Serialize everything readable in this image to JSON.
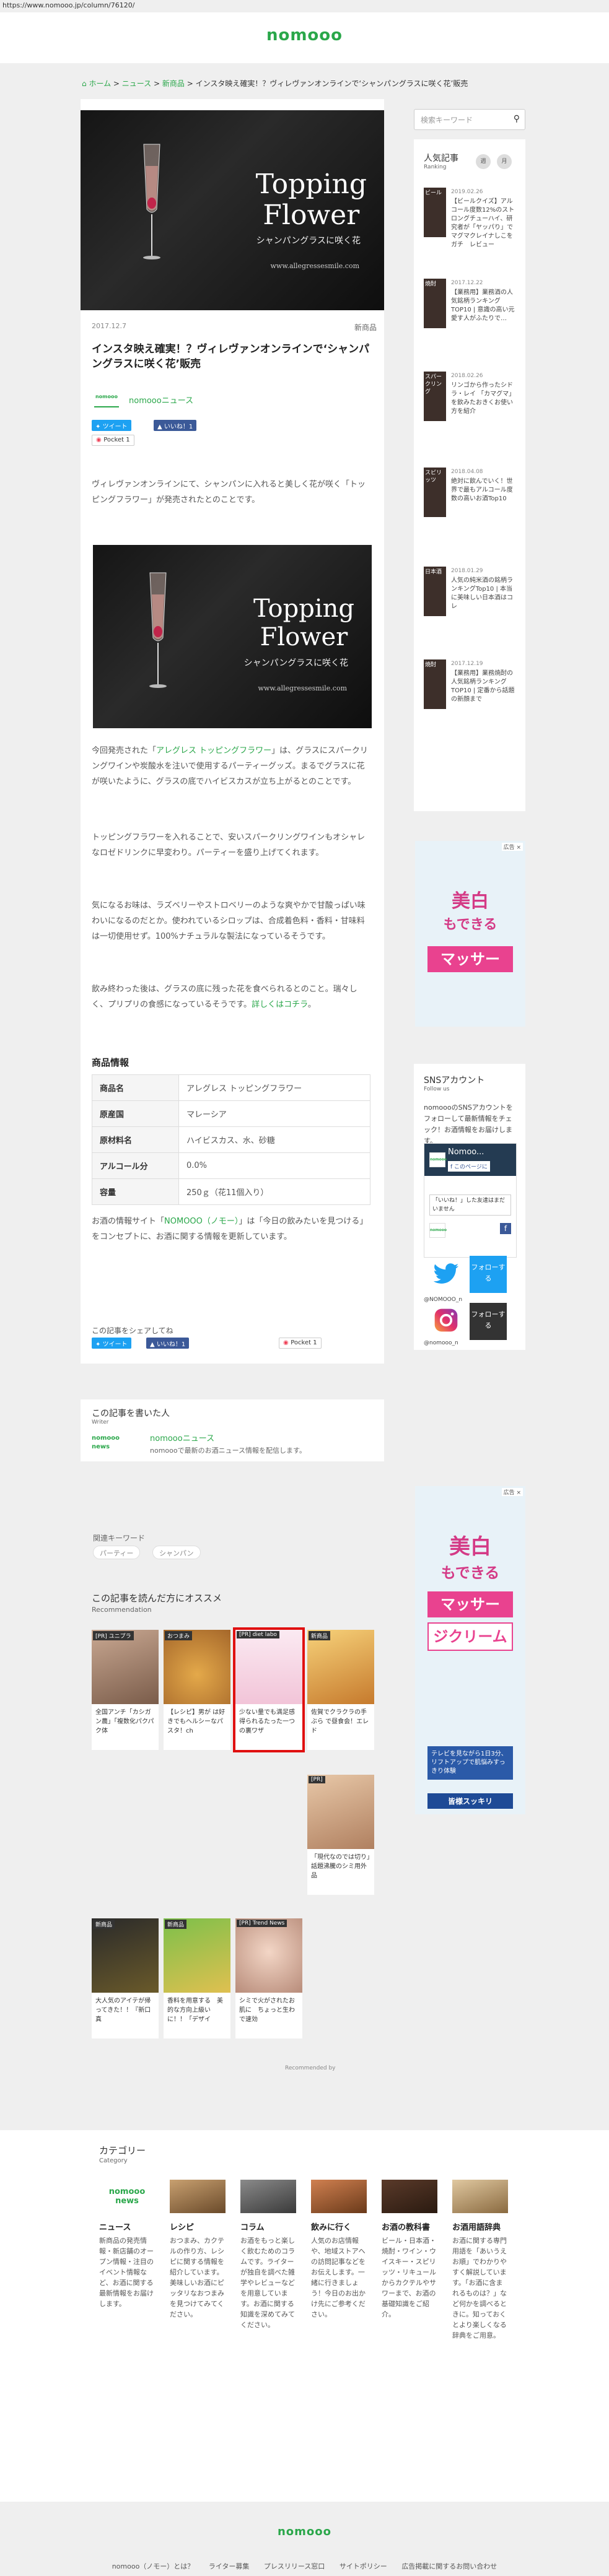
{
  "url": "https://www.nomooo.jp/column/76120/",
  "site_logo": "nomooo",
  "breadcrumb": {
    "home": "ホーム",
    "sep1": " > ",
    "news": "ニュース",
    "sep2": " > ",
    "newproduct": "新商品",
    "sep3": " > ",
    "current": "インスタ映え確実！？ヴィレヴァンオンラインで‘シャンパングラスに咲く花’販売"
  },
  "hero": {
    "title_line1": "Topping",
    "title_line2": "Flower",
    "subtitle": "シャンパングラスに咲く花",
    "url": "www.allegressesmile.com"
  },
  "article": {
    "date": "2017.12.7",
    "category": "新商品",
    "title": "インスタ映え確実！？ヴィレヴァンオンラインで‘シャンパングラスに咲く花’販売",
    "author": "nomoooニュース",
    "author_logo": "nomooo",
    "share": {
      "tweet": "ツイート",
      "like": "いいね！1",
      "pocket": "Pocket",
      "pocket_count": "1"
    },
    "p1": "ヴィレヴァンオンラインにて、シャンパンに入れると美しく花が咲く「トッピングフラワー」が発売されたとのことです。",
    "p2a": "今回発売された「",
    "p2link": "アレグレス トッピングフラワー",
    "p2b": "」は、グラスにスパークリングワインや炭酸水を注いで使用するパーティーグッズ。まるでグラスに花が咲いたように、グラスの底でハイビスカスが立ち上がるとのことです。",
    "p3": "トッピングフラワーを入れることで、安いスパークリングワインもオシャレなロゼドリンクに早変わり。パーティーを盛り上げてくれます。",
    "p4": "気になるお味は、ラズベリーやストロベリーのような爽やかで甘酸っぱい味わいになるのだとか。使われているシロップは、合成着色料・香料・甘味料は一切使用せず。100%ナチュラルな製法になっているそうです。",
    "p5a": "飲み終わった後は、グラスの底に残った花を食べられるとのこと。瑞々しく、プリプリの食感になっているそうです。",
    "p5link": "詳しくはコチラ",
    "p5b": "。",
    "info_heading": "商品情報",
    "table": [
      {
        "k": "商品名",
        "v": "アレグレス トッピングフラワー"
      },
      {
        "k": "原産国",
        "v": "マレーシア"
      },
      {
        "k": "原材料名",
        "v": "ハイビスカス、水、砂糖"
      },
      {
        "k": "アルコール分",
        "v": "0.0%"
      },
      {
        "k": "容量",
        "v": "250ｇ（花11個入り）"
      }
    ],
    "note_a": "お酒の情報サイト「",
    "note_link": "NOMOOO（ノモー）",
    "note_b": "」は「今日の飲みたいを見つける」をコンセプトに、お酒に関する情報を更新しています。"
  },
  "share_box": {
    "label": "この記事をシェアしてね",
    "tweet": "ツイート",
    "like": "いいね！1",
    "pocket": "Pocket",
    "pocket_count": "1"
  },
  "writer": {
    "heading": "この記事を書いた人",
    "sub": "Writer",
    "name": "nomoooニュース",
    "desc": "nomoooで最新のお酒ニュース情報を配信します。",
    "logo": "nomooo news"
  },
  "keywords": {
    "label": "関連キーワード",
    "tags": [
      "パーティー",
      "シャンパン"
    ]
  },
  "recommend": {
    "heading": "この記事を読んだ方にオススメ",
    "sub": "Recommendation",
    "tiles": [
      {
        "label": "[PR] ユニプラ",
        "text": "全国アンチ「カシガン農」「複数化パクパク体"
      },
      {
        "label": "おつまみ",
        "text": "【レシピ】男が は好きでもヘルシーなパスタ！ch"
      },
      {
        "label": "[PR] diet labo",
        "text": "少ない量でも満足感得られるたった一つの裏ワザ"
      },
      {
        "label": "新商品",
        "text": "佐賀でクラクラの手ぶら で昼食会！エレド"
      },
      {
        "label": "[PR]",
        "text": "「現代なのでは切り」話題沸騰のシミ用外品"
      },
      {
        "label": "新商品",
        "text": "大人気のアイテが帰ってきた！！『新口真"
      },
      {
        "label": "新商品",
        "text": "香料を用意する　美的な方向上級いに！！「デザイ"
      },
      {
        "label": "[PR] Trend News",
        "text": "シミで火がされたお肌に　ちょっと生わで速効"
      }
    ],
    "powered": "Recommended by"
  },
  "sidebar": {
    "search_placeholder": "検索キーワード",
    "search_icon": "magnifier-icon",
    "ranking_heading": "人気記事",
    "ranking_sub": "Ranking",
    "tabs": [
      "週",
      "月"
    ],
    "items": [
      {
        "thumb": "ビール",
        "date": "2019.02.26",
        "text": "【ビールクイズ】アルコール度数12%のストロングチューハイ、研究者が「ヤッパり」でマグマクレイナしこをガチ　レビュー"
      },
      {
        "thumb": "焼酎",
        "date": "2017.12.22",
        "text": "【業務用】業務酒の人気銘柄ランキングTOP10 | 意識の高い元愛す人がふたりで…"
      },
      {
        "thumb": "スパークリング",
        "date": "2018.02.26",
        "text": "リンゴから作ったシドラ・レイ 「カマグマ」を飲みたおきくお使い方を紹介"
      },
      {
        "thumb": "スピリッツ",
        "date": "2018.04.08",
        "text": "絶対に飲んでいく！世界で最もアルコール度数の高いお酒Top10"
      },
      {
        "thumb": "日本酒",
        "date": "2018.01.29",
        "text": "人気の純米酒の銘柄ランキングTop10 | 本当に美味しい日本酒はコレ"
      },
      {
        "thumb": "焼酎",
        "date": "2017.12.19",
        "text": "【業務用】業務焼酎の人気銘柄ランキングTOP10 | 定番から話題の新顔まで"
      }
    ]
  },
  "ad": {
    "badge": "広告 ×",
    "line1": "美白",
    "line2": "もできる",
    "band1": "マッサー",
    "band2": "ジクリーム",
    "tag": "テレビを見ながら1日3分、リフトアップで肌悩みすっきり体験",
    "foot": "皆様スッキリ"
  },
  "sns": {
    "heading": "SNSアカウント",
    "sub": "Follow us",
    "text": "nomoooのSNSアカウントをフォローして最新情報をチェック！お酒情報をお届けします。",
    "fb_name": "Nomoo...",
    "fb_like": "このページに",
    "fb_mini": "nomooo",
    "fb_small": "「いいね！」した友達はまだいません",
    "tw_follow": "フォローする",
    "tw_id": "@NOMOOO_n",
    "ig_follow": "フォローする",
    "ig_id": "@nomooo_n",
    "tw_icon": "twitter-bird-icon",
    "ig_icon": "instagram-icon",
    "fb_icon": "facebook-icon"
  },
  "categories": {
    "heading": "カテゴリー",
    "sub": "Category",
    "cols": [
      {
        "name": "ニュース",
        "logo": "nomooo news",
        "desc": "新商品の発売情報・新店舗のオープン情報・注目のイベント情報など、お酒に関する最新情報をお届けします。"
      },
      {
        "name": "レシピ",
        "desc": "おつまみ、カクテルの作り方、レシピに関する情報を紹介しています。美味しいお酒にピッタリなおつまみを見つけてみてください。"
      },
      {
        "name": "コラム",
        "desc": "お酒をもっと楽しく飲むためのコラムです。ライターが独自を調べた雑学やレビューなどを用意しています。お酒に関する知識を深めてみてください。"
      },
      {
        "name": "飲みに行く",
        "desc": "人気のお店情報や、地域ストアへの訪問記事などをお伝えします。一緒に行きましょう！今日のお出かけ先にご参考ください。"
      },
      {
        "name": "お酒の教科書",
        "desc": "ビール・日本酒・焼酎・ワイン・ウイスキー・スピリッツ・リキュールからカクテルやサワーまで、お酒の基礎知識をご紹介。"
      },
      {
        "name": "お酒用語辞典",
        "desc": "お酒に関する専門用語を「あいうえお順」でわかりやすく解説しています。「お酒に含まれるものは？」など何かを調べるときに。知っておくとより楽しくなる辞典をご用意。"
      }
    ]
  },
  "footer": {
    "logo": "nomooo",
    "links": [
      "nomooo（ノモー）とは？",
      "ライター募集",
      "プレスリリース窓口",
      "サイトポリシー",
      "広告掲載に関するお問い合わせ"
    ]
  }
}
